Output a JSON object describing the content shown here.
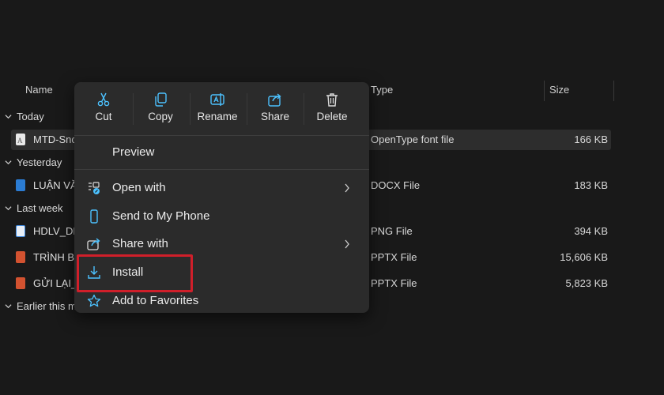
{
  "columns": {
    "name": "Name",
    "type": "Type",
    "size": "Size"
  },
  "groups": [
    {
      "label": "Today"
    },
    {
      "label": "Yesterday"
    },
    {
      "label": "Last week"
    },
    {
      "label": "Earlier this m"
    }
  ],
  "files": [
    {
      "name": "MTD-Sno",
      "type": "OpenType font file",
      "size": "166 KB",
      "icon": "font-file-icon",
      "color": "#9aa0a6"
    },
    {
      "name": "LUẬN VĂ",
      "type": "DOCX File",
      "size": "183 KB",
      "icon": "word-file-icon",
      "color": "#2b7cd3"
    },
    {
      "name": "HDLV_DL",
      "type": "PNG File",
      "size": "394 KB",
      "icon": "image-file-icon",
      "color": "#3f8ae0"
    },
    {
      "name": "TRÌNH BÀ",
      "type": "PPTX File",
      "size": "15,606 KB",
      "icon": "powerpoint-file-icon",
      "color": "#d35230"
    },
    {
      "name": "GỬI LẠI_",
      "type": "PPTX File",
      "size": "5,823 KB",
      "icon": "powerpoint-file-icon",
      "color": "#d35230"
    }
  ],
  "context_menu": {
    "quick_actions": [
      {
        "label": "Cut",
        "icon": "scissors-icon"
      },
      {
        "label": "Copy",
        "icon": "copy-icon"
      },
      {
        "label": "Rename",
        "icon": "rename-icon"
      },
      {
        "label": "Share",
        "icon": "share-icon"
      },
      {
        "label": "Delete",
        "icon": "trash-icon"
      }
    ],
    "items": [
      {
        "label": "Preview"
      },
      {
        "label": "Open with",
        "icon": "open-with-icon",
        "submenu": true
      },
      {
        "label": "Send to My Phone",
        "icon": "phone-icon"
      },
      {
        "label": "Share with",
        "icon": "share-with-icon",
        "submenu": true
      },
      {
        "label": "Install",
        "icon": "download-icon"
      },
      {
        "label": "Add to Favorites",
        "icon": "star-icon"
      }
    ]
  },
  "accent_color": "#4cc2ff",
  "highlight_color": "#d01f2a"
}
